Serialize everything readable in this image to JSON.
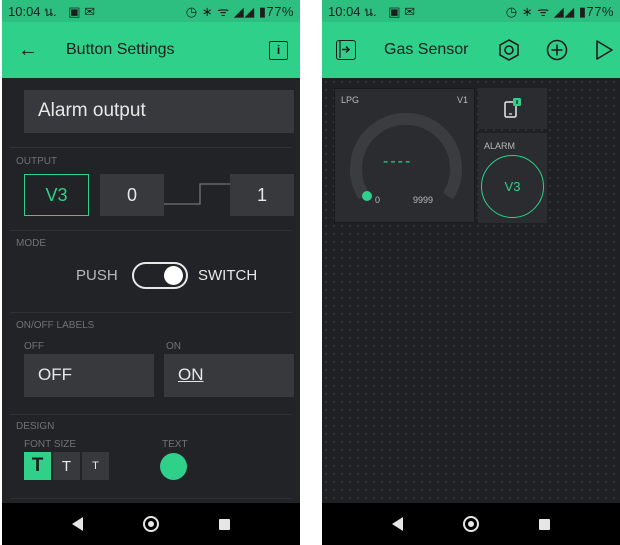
{
  "left": {
    "status": {
      "time": "10:04 น.",
      "notifs": "▣ ✉",
      "right": "◷ ∗ ᯤ ◢◢ ▮77%"
    },
    "appbar": {
      "back": "←",
      "title": "Button Settings",
      "info": "i"
    },
    "name_value": "Alarm output",
    "output": {
      "section": "OUTPUT",
      "pin": "V3",
      "low": "0",
      "high": "1"
    },
    "mode": {
      "section": "MODE",
      "push": "PUSH",
      "switch": "SWITCH"
    },
    "labels": {
      "section": "ON/OFF LABELS",
      "off_label": "OFF",
      "on_label": "ON",
      "off_value": "OFF",
      "on_value": "ON"
    },
    "design": {
      "section": "DESIGN",
      "font_size": "FONT SIZE",
      "text": "TEXT",
      "sizes": [
        "T",
        "T",
        "T"
      ],
      "text_color": "#2fd08a"
    }
  },
  "right": {
    "status": {
      "time": "10:04 น.",
      "notifs": "▣ ✉",
      "right": "◷ ∗ ᯤ ◢◢ ▮77%"
    },
    "appbar": {
      "title": "Gas Sensor"
    },
    "gauge": {
      "label": "LPG",
      "pin": "V1",
      "value": "----",
      "min": "0",
      "max": "9999"
    },
    "led": {
      "label": "ALARM",
      "pin": "V3"
    }
  },
  "colors": {
    "accent": "#2fd08a",
    "panel": "#222326",
    "field": "#37393d"
  }
}
